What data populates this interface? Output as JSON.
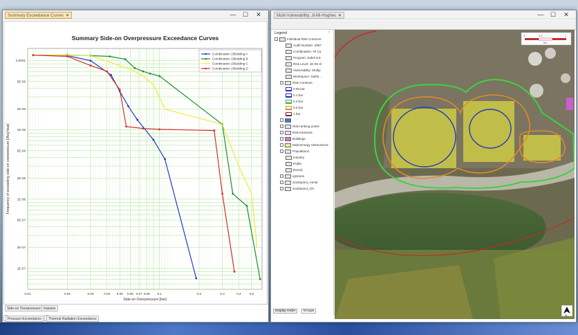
{
  "left_window": {
    "tab_label": "Summary Exceedance Curves",
    "plot_title": "Summary Side-on Overpressure Exceedance Curves",
    "lower_tabs": [
      "Side-on Overpressure",
      "Impulse"
    ],
    "bottom_tabs": [
      "Pressure Exceedance",
      "Thermal Radiation Exceedance"
    ],
    "window_controls": [
      "—",
      "☐",
      "✕"
    ]
  },
  "right_window": {
    "tab_label": "Multi-Vulnerability...8-Mi-Hughes",
    "window_controls": [
      "—",
      "☐",
      "✕"
    ],
    "legend_title": "Legend",
    "legend_items": [
      {
        "label": "Individual Risk Contours",
        "depth": 0
      },
      {
        "label": "Audit Number: 2957",
        "depth": 2
      },
      {
        "label": "Combination: All Ca",
        "depth": 2
      },
      {
        "label": "Program: Safeti 8.8",
        "depth": 2
      },
      {
        "label": "Risk Level: 1E-06 of",
        "depth": 2
      },
      {
        "label": "Vulnerability: Multip",
        "depth": 2
      },
      {
        "label": "Workspace: Safeti...",
        "depth": 2
      },
      {
        "label": "Risk Contours",
        "depth": 1
      },
      {
        "label": "0.05 bar",
        "depth": 2,
        "color": "#1f2fbf"
      },
      {
        "label": "0.1 bar",
        "depth": 2,
        "color": "#1f2fbf"
      },
      {
        "label": "0.3 bar",
        "depth": 2,
        "color": "#2fb52f"
      },
      {
        "label": "0.5 bar",
        "depth": 2,
        "color": "#e48a26"
      },
      {
        "label": "1 bar",
        "depth": 2,
        "color": "#7b2a2a"
      },
      {
        "label": "",
        "depth": 1,
        "color": "#3a7fd0"
      },
      {
        "label": "Risk ranking points",
        "depth": 1
      },
      {
        "label": "Risk transects",
        "depth": 1
      },
      {
        "label": "Buildings",
        "depth": 1,
        "color": "#d47bd9"
      },
      {
        "label": "Multi-Energy obstructions",
        "depth": 1,
        "color": "#f0f07a"
      },
      {
        "label": "Populations",
        "depth": 1
      },
      {
        "label": "Industry",
        "depth": 2
      },
      {
        "label": "Public",
        "depth": 2
      },
      {
        "label": "[None]",
        "depth": 2
      },
      {
        "label": "Ignitions",
        "depth": 1
      },
      {
        "label": "Southpoint_Aerial",
        "depth": 1
      },
      {
        "label": "Southpoint_OS",
        "depth": 1
      }
    ],
    "legend_bottom_tabs": [
      "Display Order",
      "Groups"
    ],
    "scale_labels": [
      "0",
      "0.5",
      "1"
    ],
    "scale_unit": "km",
    "north_arrow": "N"
  },
  "chart_data": {
    "type": "line",
    "title": "Summary Side-on Overpressure Exceedance Curves",
    "xlabel": "Side-on Overpressure [bar]",
    "ylabel": "Frequency of exceeding side-on overpressure [/AvgYear]",
    "xscale": "log",
    "yscale": "log",
    "xlim": [
      0.01,
      0.6
    ],
    "ylim": [
      5e-08,
      0.00015
    ],
    "xticks": [
      0.01,
      0.02,
      0.03,
      0.04,
      0.05,
      0.06,
      0.07,
      0.08,
      0.1,
      0.2,
      0.3,
      0.4,
      0.5
    ],
    "xtick_labels": [
      "0.01",
      "0.02",
      "0.03",
      "0.04",
      "0.05",
      "0.06",
      "0.07",
      "0.08",
      "0.1",
      "0.2",
      "0.3",
      "0.4",
      "0.5"
    ],
    "yticks": [
      0.0001,
      5e-05,
      2e-05,
      1e-05,
      5e-06,
      2e-06,
      1e-06,
      5e-07,
      2e-07,
      1e-07
    ],
    "ytick_labels": [
      "0.0001",
      "5E-05",
      "2E-05",
      "1E-05",
      "5E-06",
      "2E-06",
      "1E-06",
      "5E-07",
      "2E-07",
      "1E-07"
    ],
    "grid": true,
    "legend_position": "top-right",
    "series": [
      {
        "name": "Combination 1\\Building A",
        "color": "#2239c8",
        "marker": "circle",
        "x": [
          0.011,
          0.02,
          0.03,
          0.043,
          0.05,
          0.058,
          0.068,
          0.09,
          0.11,
          0.19
        ],
        "y": [
          0.00012,
          0.000118,
          0.0001,
          6.2e-05,
          3.6e-05,
          2.2e-05,
          1.4e-05,
          7.2e-06,
          3.8e-06,
          7.2e-08
        ]
      },
      {
        "name": "Combination 1\\Building B",
        "color": "#1f8c2c",
        "marker": "circle",
        "x": [
          0.011,
          0.02,
          0.03,
          0.042,
          0.055,
          0.065,
          0.075,
          0.085,
          0.1,
          0.3,
          0.36,
          0.46,
          0.58
        ],
        "y": [
          0.00012,
          0.00012,
          0.000118,
          0.000115,
          0.000105,
          7.8e-05,
          7e-05,
          6.5e-05,
          6e-05,
          1.2e-05,
          1.2e-06,
          8e-07,
          7e-08
        ]
      },
      {
        "name": "Combination 1\\Building C",
        "color": "#f2e93a",
        "marker": "none",
        "x": [
          0.011,
          0.03,
          0.05,
          0.06,
          0.075,
          0.09,
          0.11,
          0.3,
          0.4,
          0.5,
          0.55
        ],
        "y": [
          0.00012,
          0.000118,
          8.5e-05,
          7.5e-05,
          6e-05,
          4.5e-05,
          2e-05,
          1.2e-05,
          3e-06,
          1.2e-06,
          2e-07
        ]
      },
      {
        "name": "Combination 1\\Building D",
        "color": "#d62b2b",
        "marker": "circle",
        "x": [
          0.011,
          0.02,
          0.03,
          0.04,
          0.05,
          0.056,
          0.075,
          0.1,
          0.26,
          0.3,
          0.37
        ],
        "y": [
          0.00012,
          0.000115,
          8.5e-05,
          7e-05,
          3.8e-05,
          1.12e-05,
          1.05e-05,
          1.02e-05,
          9.8e-06,
          1.2e-06,
          9e-08
        ]
      }
    ]
  }
}
